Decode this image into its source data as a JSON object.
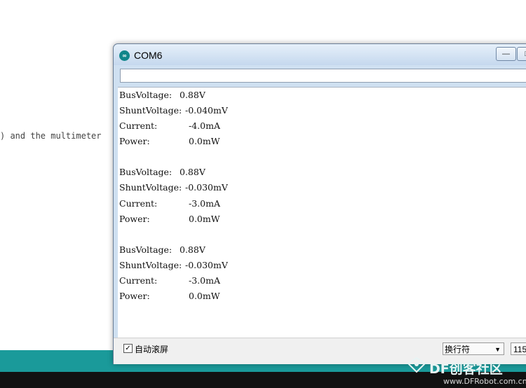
{
  "background": {
    "text_fragment": ") and the multimeter"
  },
  "window": {
    "title": "COM6",
    "min_glyph": "—",
    "max_glyph": "□"
  },
  "serial_input": {
    "value": ""
  },
  "output": {
    "blocks": [
      {
        "bus_label": "BusVoltage:",
        "bus_value": "0.88V",
        "shunt_label": "ShuntVoltage:",
        "shunt_value": "-0.040mV",
        "current_label": "Current:",
        "current_value": "-4.0mA",
        "power_label": "Power:",
        "power_value": "0.0mW"
      },
      {
        "bus_label": "BusVoltage:",
        "bus_value": "0.88V",
        "shunt_label": "ShuntVoltage:",
        "shunt_value": "-0.030mV",
        "current_label": "Current:",
        "current_value": "-3.0mA",
        "power_label": "Power:",
        "power_value": "0.0mW"
      },
      {
        "bus_label": "BusVoltage:",
        "bus_value": "0.88V",
        "shunt_label": "ShuntVoltage:",
        "shunt_value": "-0.030mV",
        "current_label": "Current:",
        "current_value": "-3.0mA",
        "power_label": "Power:",
        "power_value": "0.0mW"
      }
    ]
  },
  "footer": {
    "autoscroll_label": "自动滚屏",
    "autoscroll_checked": "✓",
    "line_ending": "换行符",
    "baud": "115"
  },
  "watermark": {
    "brand": "DF创客社区",
    "url": "www.DFRobot.com.cn"
  },
  "colors": {
    "teal": "#1a9a9a",
    "arduino_teal": "#11868b"
  }
}
